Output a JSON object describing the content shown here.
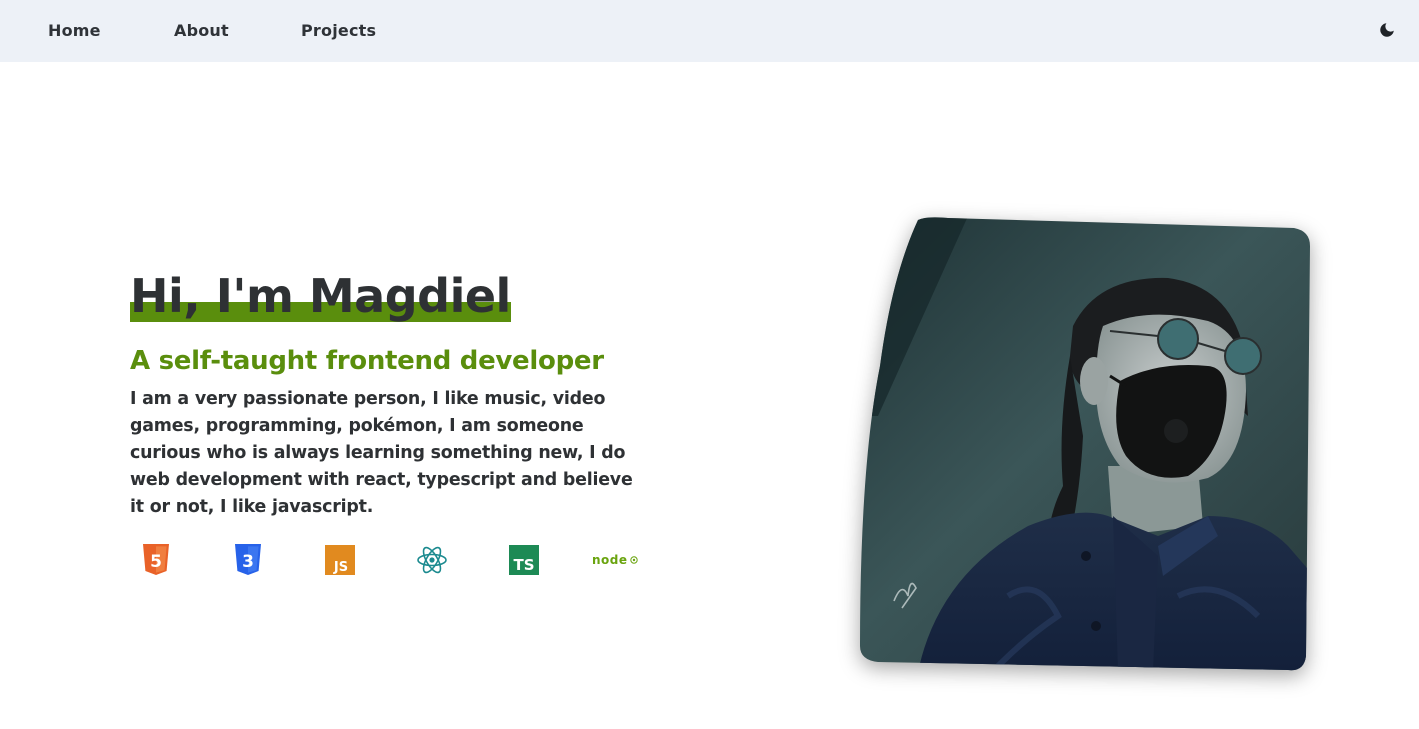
{
  "nav": {
    "links": [
      "Home",
      "About",
      "Projects"
    ],
    "theme_toggle_icon": "moon-icon"
  },
  "hero": {
    "title": "Hi, I'm Magdiel",
    "subtitle": "A self-taught frontend developer",
    "bio": "I am a very passionate person, I like music, video games, programming, pokémon, I am someone curious who is always learning something new, I do web development with react, typescript and believe it or not, I like javascript."
  },
  "tech_icons": [
    {
      "name": "html5-icon",
      "label": "5",
      "color": "#e96228"
    },
    {
      "name": "css3-icon",
      "label": "3",
      "color": "#2762e9"
    },
    {
      "name": "javascript-icon",
      "label": "JS",
      "color": "#e18a1f"
    },
    {
      "name": "react-icon",
      "label": "",
      "color": "#1b8a8f"
    },
    {
      "name": "typescript-icon",
      "label": "TS",
      "color": "#1d8a55"
    },
    {
      "name": "nodejs-icon",
      "label": "node",
      "color": "#6aa40f"
    }
  ],
  "colors": {
    "accent": "#5a8e0d",
    "nav_bg": "#edf1f7",
    "text": "#2e3134"
  }
}
